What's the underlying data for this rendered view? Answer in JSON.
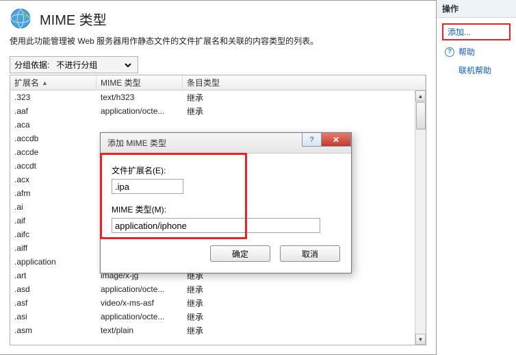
{
  "header": {
    "title": "MIME 类型",
    "description": "使用此功能管理被 Web 服务器用作静态文件的文件扩展名和关联的内容类型的列表。"
  },
  "group": {
    "label": "分组依据:",
    "selected": "不进行分组"
  },
  "columns": {
    "ext": "扩展名",
    "mime": "MIME 类型",
    "entry": "条目类型"
  },
  "rows": [
    {
      "ext": ".323",
      "mime": "text/h323",
      "entry": "继承"
    },
    {
      "ext": ".aaf",
      "mime": "application/octe...",
      "entry": "继承"
    },
    {
      "ext": ".aca",
      "mime": "",
      "entry": ""
    },
    {
      "ext": ".accdb",
      "mime": "",
      "entry": ""
    },
    {
      "ext": ".accde",
      "mime": "",
      "entry": ""
    },
    {
      "ext": ".accdt",
      "mime": "",
      "entry": ""
    },
    {
      "ext": ".acx",
      "mime": "",
      "entry": ""
    },
    {
      "ext": ".afm",
      "mime": "",
      "entry": ""
    },
    {
      "ext": ".ai",
      "mime": "",
      "entry": ""
    },
    {
      "ext": ".aif",
      "mime": "",
      "entry": ""
    },
    {
      "ext": ".aifc",
      "mime": "",
      "entry": ""
    },
    {
      "ext": ".aiff",
      "mime": "",
      "entry": ""
    },
    {
      "ext": ".application",
      "mime": "",
      "entry": ""
    },
    {
      "ext": ".art",
      "mime": "image/x-jg",
      "entry": "继承"
    },
    {
      "ext": ".asd",
      "mime": "application/octe...",
      "entry": "继承"
    },
    {
      "ext": ".asf",
      "mime": "video/x-ms-asf",
      "entry": "继承"
    },
    {
      "ext": ".asi",
      "mime": "application/octe...",
      "entry": "继承"
    },
    {
      "ext": ".asm",
      "mime": "text/plain",
      "entry": "继承"
    }
  ],
  "dialog": {
    "title": "添加 MIME 类型",
    "ext_label": "文件扩展名(E):",
    "ext_value": ".ipa",
    "mime_label": "MIME 类型(M):",
    "mime_value": "application/iphone",
    "ok": "确定",
    "cancel": "取消"
  },
  "actions": {
    "header": "操作",
    "add": "添加...",
    "help": "帮助",
    "online_help": "联机帮助"
  }
}
